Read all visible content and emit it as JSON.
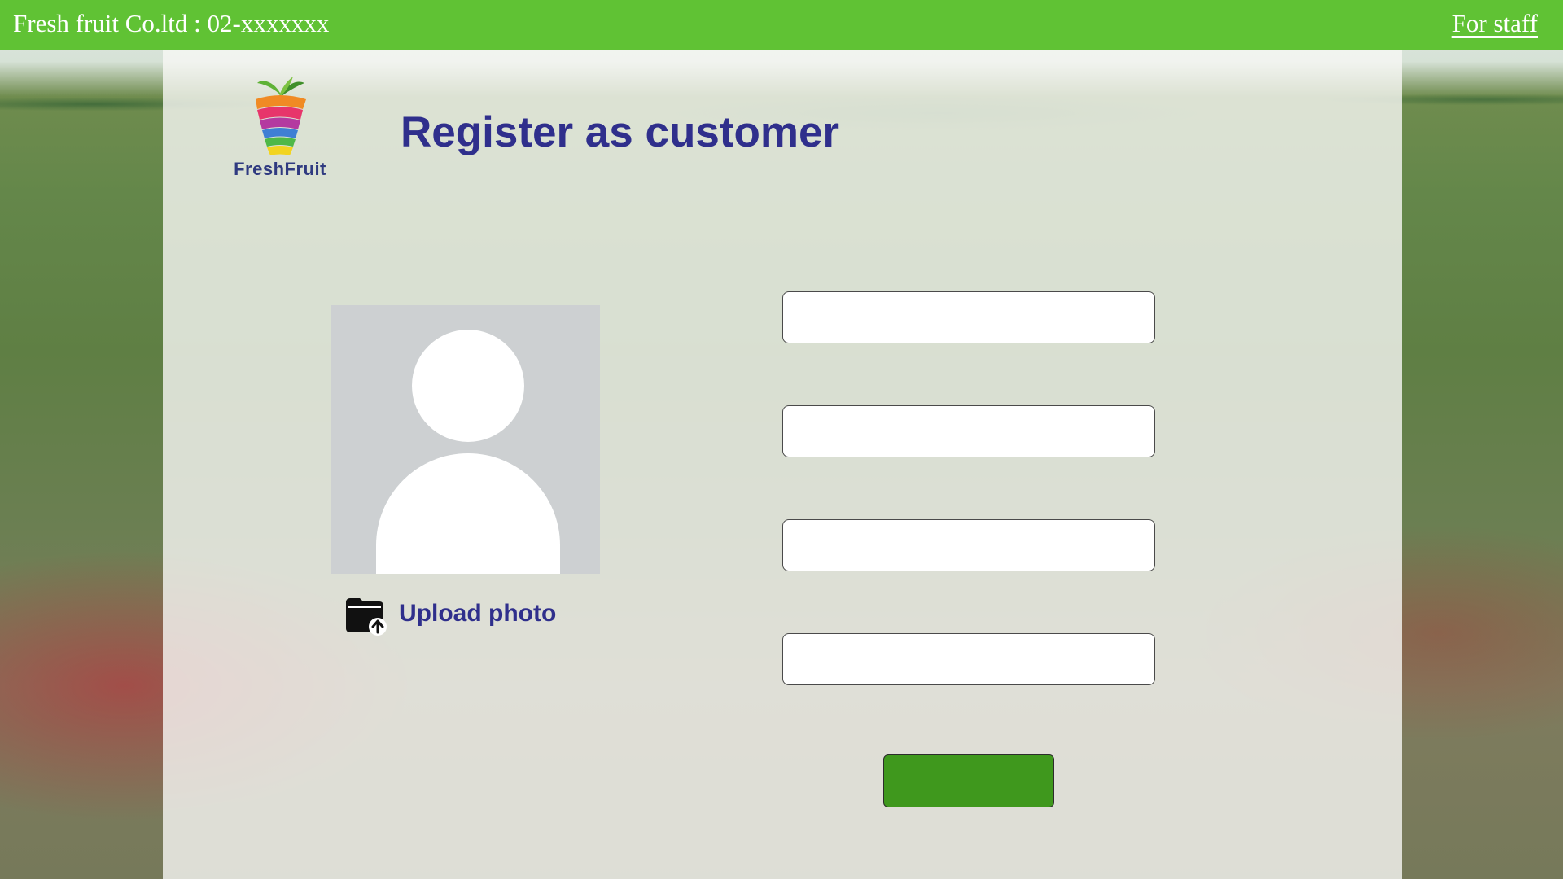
{
  "header": {
    "company": "Fresh fruit Co.ltd : 02-xxxxxxx",
    "staff_link": "For staff"
  },
  "logo": {
    "word": "FreshFruit",
    "icon": "fruit-basket-logo"
  },
  "page": {
    "title": "Register as customer"
  },
  "profile": {
    "avatar_icon": "user-placeholder-icon",
    "upload_label": "Upload photo",
    "upload_icon": "folder-upload-icon"
  },
  "form": {
    "fields": [
      {
        "value": "",
        "placeholder": ""
      },
      {
        "value": "",
        "placeholder": ""
      },
      {
        "value": "",
        "placeholder": ""
      },
      {
        "value": "",
        "placeholder": ""
      }
    ],
    "submit_label": ""
  },
  "colors": {
    "header_bar": "#60c234",
    "title": "#2f2f8c",
    "submit_button": "#3f981d",
    "avatar_bg": "#cdd0d2"
  }
}
